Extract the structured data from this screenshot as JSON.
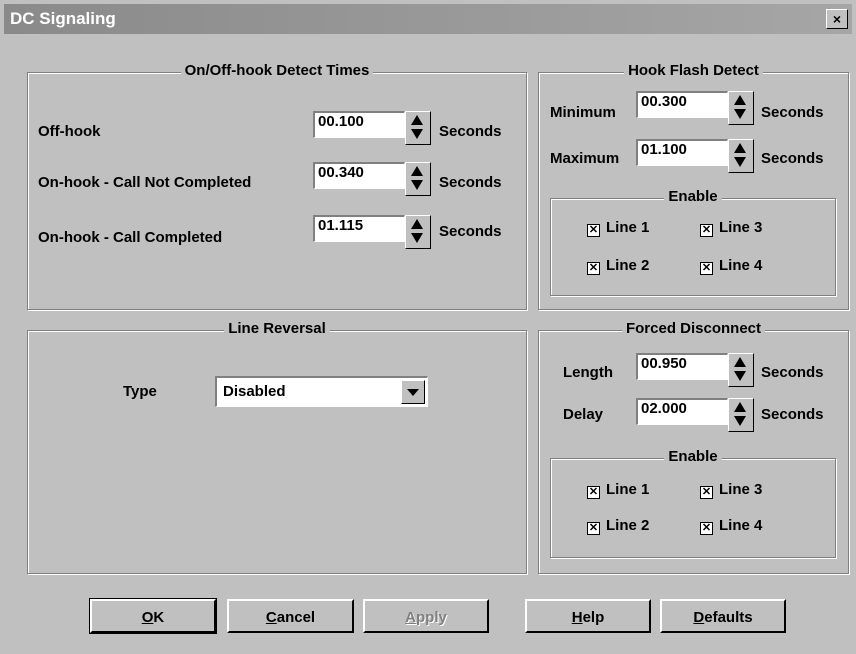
{
  "window": {
    "title": "DC Signaling",
    "close_label": "×"
  },
  "detect_times": {
    "title": "On/Off-hook Detect Times",
    "unit": "Seconds",
    "rows": [
      {
        "label": "Off-hook",
        "value": "00.100"
      },
      {
        "label": "On-hook - Call Not Completed",
        "value": "00.340"
      },
      {
        "label": "On-hook - Call Completed",
        "value": "01.115"
      }
    ]
  },
  "hook_flash": {
    "title": "Hook Flash Detect",
    "unit": "Seconds",
    "min_label": "Minimum",
    "min_value": "00.300",
    "max_label": "Maximum",
    "max_value": "01.100",
    "enable_title": "Enable",
    "lines": [
      {
        "label": "Line 1",
        "checked": true
      },
      {
        "label": "Line 2",
        "checked": true
      },
      {
        "label": "Line 3",
        "checked": true
      },
      {
        "label": "Line 4",
        "checked": true
      }
    ]
  },
  "line_reversal": {
    "title": "Line Reversal",
    "type_label": "Type",
    "type_value": "Disabled"
  },
  "forced_disconnect": {
    "title": "Forced Disconnect",
    "unit": "Seconds",
    "length_label": "Length",
    "length_value": "00.950",
    "delay_label": "Delay",
    "delay_value": "02.000",
    "enable_title": "Enable",
    "lines": [
      {
        "label": "Line 1",
        "checked": true
      },
      {
        "label": "Line 2",
        "checked": true
      },
      {
        "label": "Line 3",
        "checked": true
      },
      {
        "label": "Line 4",
        "checked": true
      }
    ]
  },
  "buttons": {
    "ok_u": "O",
    "ok_rest": "K",
    "cancel_u": "C",
    "cancel_rest": "ancel",
    "apply_u": "A",
    "apply_rest": "pply",
    "help_u": "H",
    "help_rest": "elp",
    "defaults_u": "D",
    "defaults_rest": "efaults"
  }
}
